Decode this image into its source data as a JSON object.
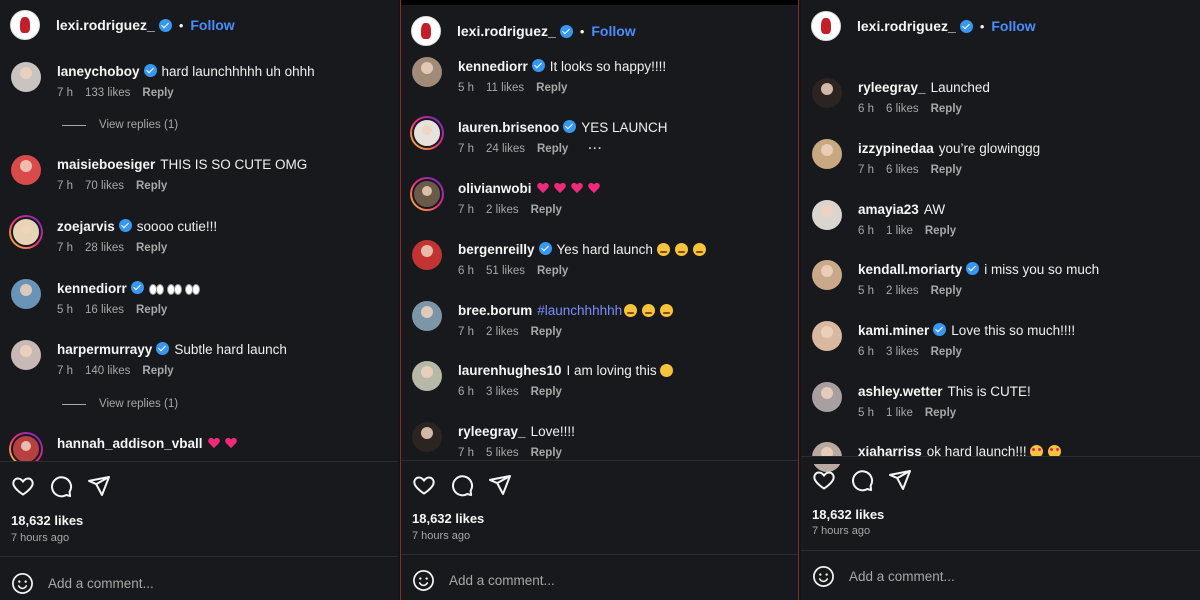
{
  "colors": {
    "bg": "#17191c",
    "accent_follow": "#4a8dff",
    "hashtag": "#7b8cff",
    "muted": "#a8a8a8",
    "verified": "#3897f0",
    "heart": "#ee2a7b",
    "panel_border": "#8a2b2b"
  },
  "post": {
    "username": "lexi.rodriguez_",
    "dot": "•",
    "follow_label": "Follow",
    "likes_text": "18,632 likes",
    "time_ago": "7 hours ago",
    "add_comment_placeholder": "Add a comment...",
    "reply_label": "Reply",
    "view_replies": "View replies (1)"
  },
  "panels": [
    {
      "comments": [
        {
          "user": "laneychoboy",
          "verified": true,
          "text": "hard launchhhhh uh ohhh",
          "time": "7 h",
          "likes": "133 likes"
        },
        {
          "user": "maisieboesiger",
          "verified": false,
          "text": "THIS IS SO CUTE OMG",
          "time": "7 h",
          "likes": "70 likes"
        },
        {
          "user": "zoejarvis",
          "verified": true,
          "text": "soooo cutie!!!",
          "time": "7 h",
          "likes": "28 likes"
        },
        {
          "user": "kennediorr",
          "verified": true,
          "text": "",
          "emoji": "eyes",
          "emoji_count": 3,
          "time": "5 h",
          "likes": "16 likes"
        },
        {
          "user": "harpermurrayy",
          "verified": true,
          "text": "Subtle hard launch",
          "time": "7 h",
          "likes": "140 likes"
        },
        {
          "user": "hannah_addison_vball",
          "verified": false,
          "text": "",
          "emoji": "heart",
          "emoji_count": 2
        }
      ]
    },
    {
      "comments": [
        {
          "user": "kennediorr",
          "verified": true,
          "text": "It looks so happy!!!!",
          "time": "5 h",
          "likes": "11 likes"
        },
        {
          "user": "lauren.brisenoo",
          "verified": true,
          "text": "YES LAUNCH",
          "time": "7 h",
          "likes": "24 likes",
          "more": "···"
        },
        {
          "user": "olivianwobi",
          "verified": false,
          "text": "",
          "emoji": "heart",
          "emoji_count": 4,
          "time": "7 h",
          "likes": "2 likes"
        },
        {
          "user": "bergenreilly",
          "verified": true,
          "text": "Yes hard launch",
          "emoji": "teary",
          "emoji_count": 3,
          "time": "6 h",
          "likes": "51 likes"
        },
        {
          "user": "bree.borum",
          "verified": false,
          "text": "#launchhhhhh",
          "hashtag": true,
          "emoji": "teary",
          "emoji_count": 3,
          "time": "7 h",
          "likes": "2 likes"
        },
        {
          "user": "laurenhughes10",
          "verified": false,
          "text": "I am loving this",
          "emoji": "smile",
          "emoji_count": 1,
          "time": "6 h",
          "likes": "3 likes"
        },
        {
          "user": "ryleegray_",
          "verified": false,
          "text": "Love!!!!",
          "time": "7 h",
          "likes": "5 likes"
        }
      ]
    },
    {
      "comments": [
        {
          "user": "ryleegray_",
          "verified": false,
          "text": "Launched",
          "time": "6 h",
          "likes": "6 likes"
        },
        {
          "user": "izzypinedaa",
          "verified": false,
          "text": "you’re glowinggg",
          "time": "7 h",
          "likes": "6 likes"
        },
        {
          "user": "amayia23",
          "verified": false,
          "text": "AW",
          "time": "6 h",
          "likes": "1 like"
        },
        {
          "user": "kendall.moriarty",
          "verified": true,
          "text": "i miss you so much",
          "time": "5 h",
          "likes": "2 likes"
        },
        {
          "user": "kami.miner",
          "verified": true,
          "text": "Love this so much!!!!",
          "time": "6 h",
          "likes": "3 likes"
        },
        {
          "user": "ashley.wetter",
          "verified": false,
          "text": "This is CUTE!",
          "time": "5 h",
          "likes": "1 like"
        },
        {
          "user": "xiaharriss",
          "verified": false,
          "text": "ok hard launch!!!",
          "emoji": "heart-eyes",
          "emoji_count": 2
        }
      ]
    }
  ]
}
